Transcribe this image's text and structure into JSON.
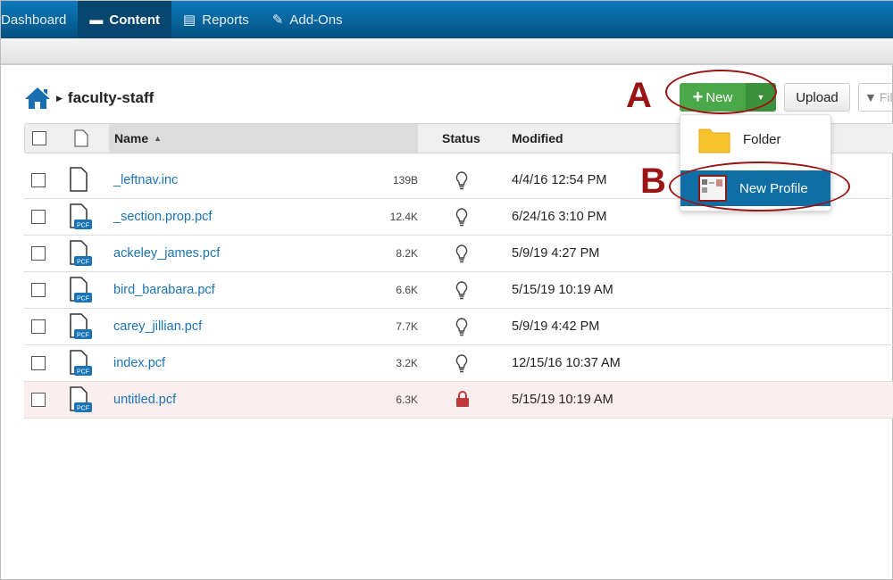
{
  "nav": {
    "items": [
      {
        "label": "Dashboard"
      },
      {
        "label": "Content"
      },
      {
        "label": "Reports"
      },
      {
        "label": "Add-Ons"
      }
    ]
  },
  "breadcrumb": {
    "folder": "faculty-staff"
  },
  "toolbar": {
    "new_label": "New",
    "upload_label": "Upload",
    "filter_placeholder": "Filter"
  },
  "table": {
    "headers": {
      "name": "Name",
      "status": "Status",
      "modified": "Modified"
    },
    "rows": [
      {
        "name": "_leftnav.inc",
        "size": "139B",
        "status": "available",
        "modified": "4/4/16 12:54 PM",
        "pcf": false
      },
      {
        "name": "_section.prop.pcf",
        "size": "12.4K",
        "status": "available",
        "modified": "6/24/16 3:10 PM",
        "pcf": true
      },
      {
        "name": "ackeley_james.pcf",
        "size": "8.2K",
        "status": "available",
        "modified": "5/9/19 4:27 PM",
        "pcf": true
      },
      {
        "name": "bird_barabara.pcf",
        "size": "6.6K",
        "status": "available",
        "modified": "5/15/19 10:19 AM",
        "pcf": true
      },
      {
        "name": "carey_jillian.pcf",
        "size": "7.7K",
        "status": "available",
        "modified": "5/9/19 4:42 PM",
        "pcf": true
      },
      {
        "name": "index.pcf",
        "size": "3.2K",
        "status": "available",
        "modified": "12/15/16 10:37 AM",
        "pcf": true
      },
      {
        "name": "untitled.pcf",
        "size": "6.3K",
        "status": "locked",
        "modified": "5/15/19 10:19 AM",
        "pcf": true
      }
    ]
  },
  "pcf_badge": "PCF",
  "menu": {
    "items": [
      {
        "label": "Folder"
      },
      {
        "label": "New Profile"
      }
    ]
  },
  "annotations": {
    "a": "A",
    "b": "B"
  },
  "colors": {
    "nav": "#0a7bbd",
    "new_button": "#4aa84a",
    "selected": "#0e6ea5",
    "annotation": "#9b1414",
    "link": "#1a73b5"
  }
}
